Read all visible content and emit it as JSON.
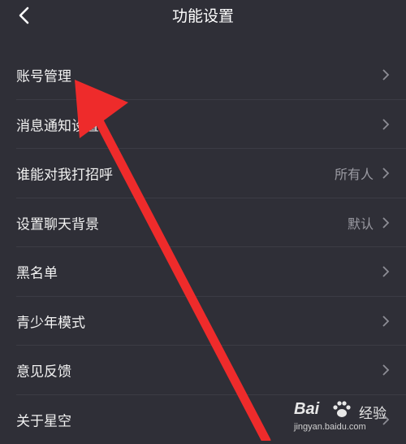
{
  "header": {
    "title": "功能设置"
  },
  "rows": [
    {
      "label": "账号管理",
      "value": ""
    },
    {
      "label": "消息通知设置",
      "value": ""
    },
    {
      "label": "谁能对我打招呼",
      "value": "所有人"
    },
    {
      "label": "设置聊天背景",
      "value": "默认"
    },
    {
      "label": "黑名单",
      "value": ""
    },
    {
      "label": "青少年模式",
      "value": ""
    },
    {
      "label": "意见反馈",
      "value": ""
    },
    {
      "label": "关于星空",
      "value": ""
    }
  ],
  "watermark": {
    "brand": "Bai",
    "cn": "经验",
    "url": "jingyan.baidu.com"
  },
  "colors": {
    "background": "#2f2f37",
    "annotation_arrow": "#ee2b2b",
    "chevron": "#8d8d95"
  }
}
